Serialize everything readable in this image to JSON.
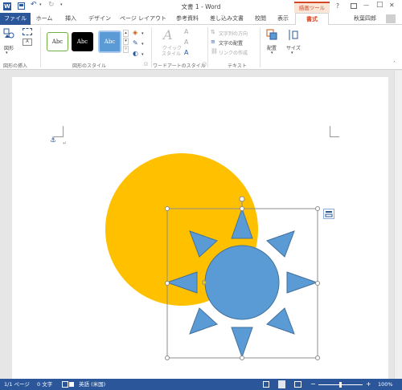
{
  "titlebar": {
    "title": "文書 1 - Word",
    "context_tab_group": "描画ツール",
    "help": "?",
    "minimize": "—",
    "maximize": "□",
    "close": "✕"
  },
  "tabs": {
    "file": "ファイル",
    "home": "ホーム",
    "insert": "挿入",
    "design": "デザイン",
    "layout": "ページ レイアウト",
    "references": "参考資料",
    "mailings": "差し込み文書",
    "review": "校閲",
    "view": "表示",
    "format": "書式",
    "user": "秋葉四郎"
  },
  "ribbon": {
    "insert_shape_label": "図形",
    "group_insert_shapes": "図形の挿入",
    "style_sample": "Abc",
    "group_shape_styles": "図形のスタイル",
    "quick_style_line1": "クイック",
    "quick_style_line2": "スタイル",
    "group_wordart": "ワードアートのスタイル",
    "text_direction": "文字列の方向",
    "align_text": "文字の配置",
    "create_link": "リンクの作成",
    "group_text": "テキスト",
    "arrange": "配置",
    "size": "サイズ"
  },
  "statusbar": {
    "page": "1/1 ページ",
    "words": "0 文字",
    "language": "英語 (米国)",
    "zoom_minus": "−",
    "zoom_plus": "+",
    "zoom": "100%"
  },
  "colors": {
    "accent": "#2b579a",
    "context_tab": "#d24726",
    "circle_orange": "#ffc000",
    "sun_blue": "#5b9bd5"
  }
}
